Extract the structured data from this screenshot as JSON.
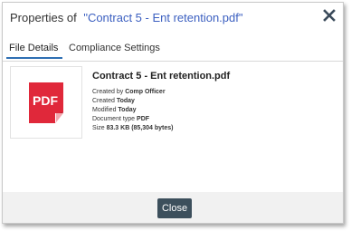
{
  "dialog": {
    "title_prefix": "Properties of",
    "title_document": "\"Contract 5 - Ent retention.pdf\"",
    "close_icon": "close-icon"
  },
  "tabs": [
    {
      "label": "File Details",
      "active": true
    },
    {
      "label": "Compliance Settings",
      "active": false
    }
  ],
  "file": {
    "name": "Contract 5 - Ent retention.pdf",
    "thumbnail_label": "PDF",
    "thumbnail_color": "#e0283a",
    "created_by_label": "Created by",
    "created_by_value": "Comp Officer",
    "created_label": "Created",
    "created_value": "Today",
    "modified_label": "Modified",
    "modified_value": "Today",
    "doc_type_label": "Document type",
    "doc_type_value": "PDF",
    "size_label": "Size",
    "size_value": "83.3 KB (85,304 bytes)"
  },
  "footer": {
    "close_label": "Close"
  },
  "colors": {
    "link": "#3b5fc0",
    "tab_underline": "#2f6fb3",
    "button_bg": "#3c4f5c",
    "footer_bg": "#f1f1f1"
  }
}
